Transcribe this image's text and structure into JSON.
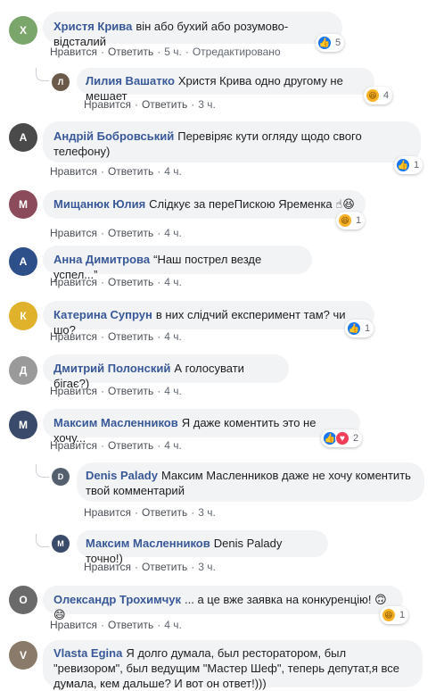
{
  "comments": [
    {
      "author": "Христя Крива",
      "text": "він або бухий або розумово-відсталий",
      "like": "Нравится",
      "reply": "Ответить",
      "time": "5 ч.",
      "edited": "Отредактировано",
      "reactions": "5"
    },
    {
      "author": "Лилия Вашатко",
      "text": "Христя Крива одно другому не мешает",
      "like": "Нравится",
      "reply": "Ответить",
      "time": "3 ч.",
      "reactions": "4"
    },
    {
      "author": "Андрій Бобровський",
      "text": "Перевіряє кути огляду щодо свого телефону)",
      "like": "Нравится",
      "reply": "Ответить",
      "time": "4 ч.",
      "reactions": "1"
    },
    {
      "author": "Мищанюк Юлия",
      "text": "Слідкує за переПискою Яременка",
      "like": "Нравится",
      "reply": "Ответить",
      "time": "4 ч.",
      "reactions": "1"
    },
    {
      "author": "Анна Димитрова",
      "text": "“Наш пострел везде успел...”",
      "like": "Нравится",
      "reply": "Ответить",
      "time": "4 ч."
    },
    {
      "author": "Катерина Супрун",
      "text": "в них слідчий експеримент там? чи шо?",
      "like": "Нравится",
      "reply": "Ответить",
      "time": "4 ч.",
      "reactions": "1"
    },
    {
      "author": "Дмитрий Полонский",
      "text": "А голосувати бігає?)",
      "like": "Нравится",
      "reply": "Ответить",
      "time": "4 ч."
    },
    {
      "author": "Максим Масленников",
      "text": "Я даже коментить это не хочу...",
      "like": "Нравится",
      "reply": "Ответить",
      "time": "4 ч.",
      "reactions": "2"
    },
    {
      "author": "Denis Palady",
      "text": "Максим Масленников даже не хочу коментить твой комментарий",
      "like": "Нравится",
      "reply": "Ответить",
      "time": "3 ч."
    },
    {
      "author": "Максим Масленников",
      "text": "Denis Palady точно!)",
      "like": "Нравится",
      "reply": "Ответить",
      "time": "3 ч."
    },
    {
      "author": "Олександр Трохимчук",
      "text": "... а це вже заявка на конкуренцію!",
      "like": "Нравится",
      "reply": "Ответить",
      "time": "4 ч.",
      "reactions": "1"
    },
    {
      "author": "Vlasta Egina",
      "text": "Я долго думала, был ресторатором, был \"ревизором\", был ведущим \"Мастер Шеф\", теперь депутат,я все думала, кем дальше? И вот он ответ!)))"
    }
  ],
  "separator": "·",
  "icons": {
    "like": "like-icon",
    "love": "love-icon",
    "haha": "haha-icon",
    "wow": "wow-icon"
  },
  "colors": {
    "author": "#385898",
    "bubble": "#f2f3f5",
    "meta": "#606770",
    "like": "#1877f2",
    "love": "#f33e58",
    "haha": "#f7b125"
  }
}
